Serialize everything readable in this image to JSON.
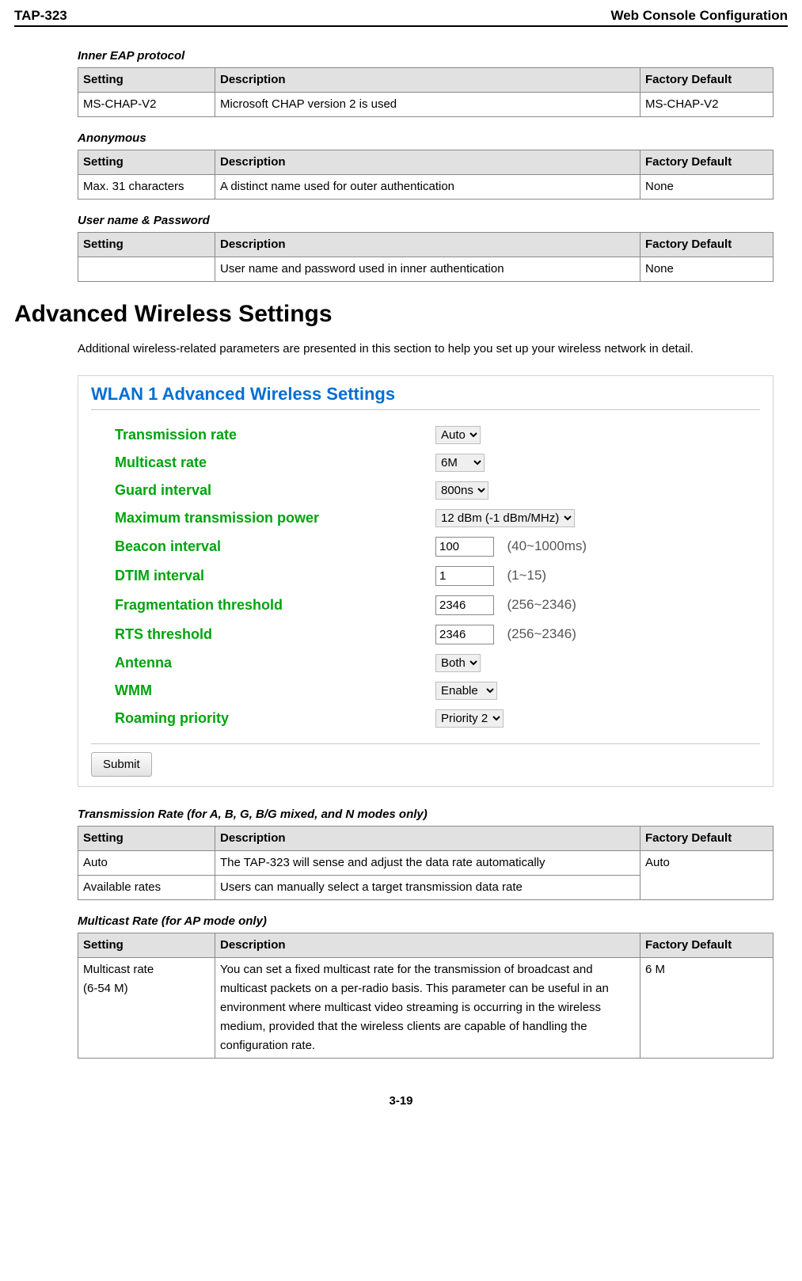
{
  "header": {
    "left": "TAP-323",
    "right": "Web Console Configuration"
  },
  "columns": {
    "setting": "Setting",
    "description": "Description",
    "default": "Factory Default"
  },
  "tables": {
    "inner_eap": {
      "title": "Inner EAP protocol",
      "rows": [
        {
          "s": "MS-CHAP-V2",
          "d": "Microsoft CHAP version 2 is used",
          "f": "MS-CHAP-V2"
        }
      ]
    },
    "anonymous": {
      "title": "Anonymous",
      "rows": [
        {
          "s": "Max. 31 characters",
          "d": "A distinct name used for outer authentication",
          "f": "None"
        }
      ]
    },
    "userpw": {
      "title": "User name & Password",
      "rows": [
        {
          "s": "",
          "d": "User name and password used in inner authentication",
          "f": "None"
        }
      ]
    },
    "txrate": {
      "title": "Transmission Rate (for A, B, G, B/G mixed, and N modes only)",
      "rows": [
        {
          "s": "Auto",
          "d": "The TAP-323 will sense and adjust the data rate automatically",
          "f": "Auto"
        },
        {
          "s": "Available rates",
          "d": "Users can manually select a target transmission data rate",
          "f": ""
        }
      ],
      "default_rowspan": 2
    },
    "mcrate": {
      "title": "Multicast Rate (for AP mode only)",
      "rows": [
        {
          "s": "Multicast rate\n(6-54 M)",
          "d": "You can set a fixed multicast rate for the transmission of broadcast and multicast packets on a per-radio basis. This parameter can be useful in an environment where multicast video streaming is occurring in the wireless medium, provided that the wireless clients are capable of handling the configuration rate.",
          "f": "6 M"
        }
      ]
    }
  },
  "heading": "Advanced Wireless Settings",
  "intro": "Additional wireless-related parameters are presented in this section to help you set up your wireless network in detail.",
  "shot": {
    "title": "WLAN 1  Advanced Wireless Settings",
    "rows": {
      "tx": {
        "label": "Transmission rate",
        "value": "Auto"
      },
      "mc": {
        "label": "Multicast rate",
        "value": "6M"
      },
      "guard": {
        "label": "Guard interval",
        "value": "800ns"
      },
      "maxtx": {
        "label": "Maximum transmission power",
        "value": "12 dBm (-1 dBm/MHz)"
      },
      "beacon": {
        "label": "Beacon interval",
        "value": "100",
        "hint": "(40~1000ms)"
      },
      "dtim": {
        "label": "DTIM interval",
        "value": "1",
        "hint": "(1~15)"
      },
      "frag": {
        "label": "Fragmentation threshold",
        "value": "2346",
        "hint": "(256~2346)"
      },
      "rts": {
        "label": "RTS threshold",
        "value": "2346",
        "hint": "(256~2346)"
      },
      "ant": {
        "label": "Antenna",
        "value": "Both"
      },
      "wmm": {
        "label": "WMM",
        "value": "Enable"
      },
      "roam": {
        "label": "Roaming priority",
        "value": "Priority 2"
      }
    },
    "submit": "Submit"
  },
  "page_num": "3-19"
}
